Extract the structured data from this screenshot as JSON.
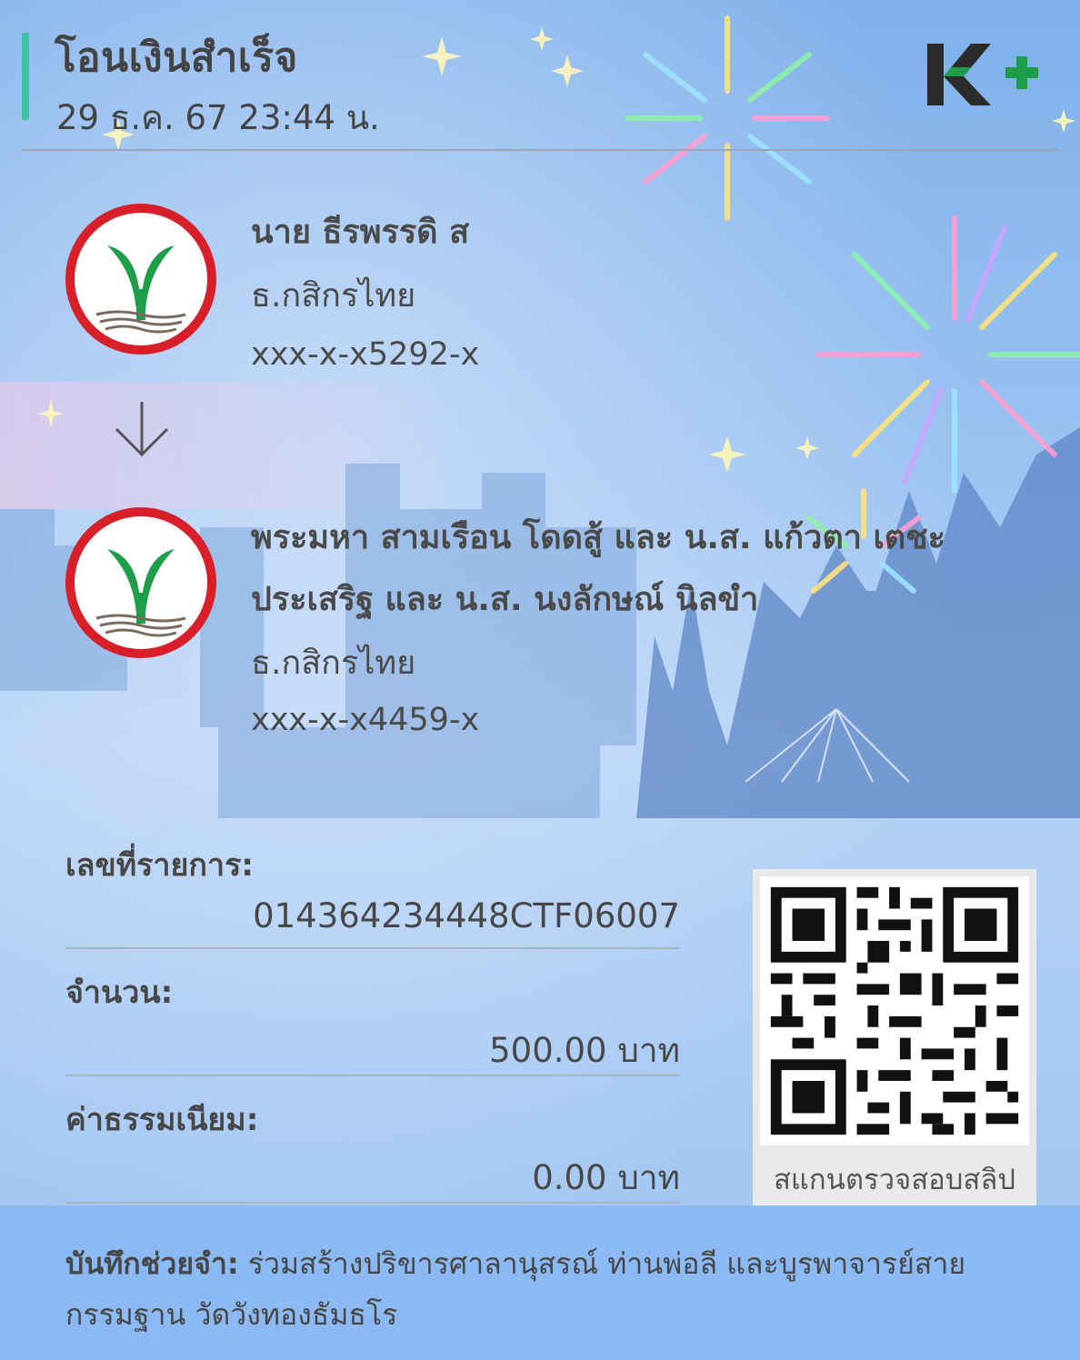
{
  "header": {
    "title": "โอนเงินสำเร็จ",
    "datetime": "29 ธ.ค. 67  23:44 น.",
    "brand_logo": "K+"
  },
  "sender": {
    "name": "นาย ธีรพรรดิ ส",
    "bank": "ธ.กสิกรไทย",
    "account": "xxx-x-x5292-x"
  },
  "receiver": {
    "name_line1": "พระมหา สามเรือน โดดสู้ และ น.ส. แก้วตา เตชะ",
    "name_line2": "ประเสริฐ และ น.ส. นงลักษณ์ นิลขำ",
    "bank": "ธ.กสิกรไทย",
    "account": "xxx-x-x4459-x"
  },
  "details": {
    "ref_label": "เลขที่รายการ:",
    "ref_value": "014364234448CTF06007",
    "amount_label": "จำนวน:",
    "amount_value": "500.00 บาท",
    "fee_label": "ค่าธรรมเนียม:",
    "fee_value": "0.00 บาท"
  },
  "qr": {
    "caption": "สแกนตรวจสอบสลิป"
  },
  "memo": {
    "label": "บันทึกช่วยจำ:",
    "text": "ร่วมสร้างปริขารศาลานุสรณ์ ท่านพ่อลี และบูรพาจารย์สายกรรมฐาน วัดวังทองธัมธโร"
  },
  "colors": {
    "accent": "#3fc1a4",
    "kbank_green": "#1f9e49",
    "kbank_red": "#d8202a",
    "memo_band": "#8ab9f4"
  }
}
